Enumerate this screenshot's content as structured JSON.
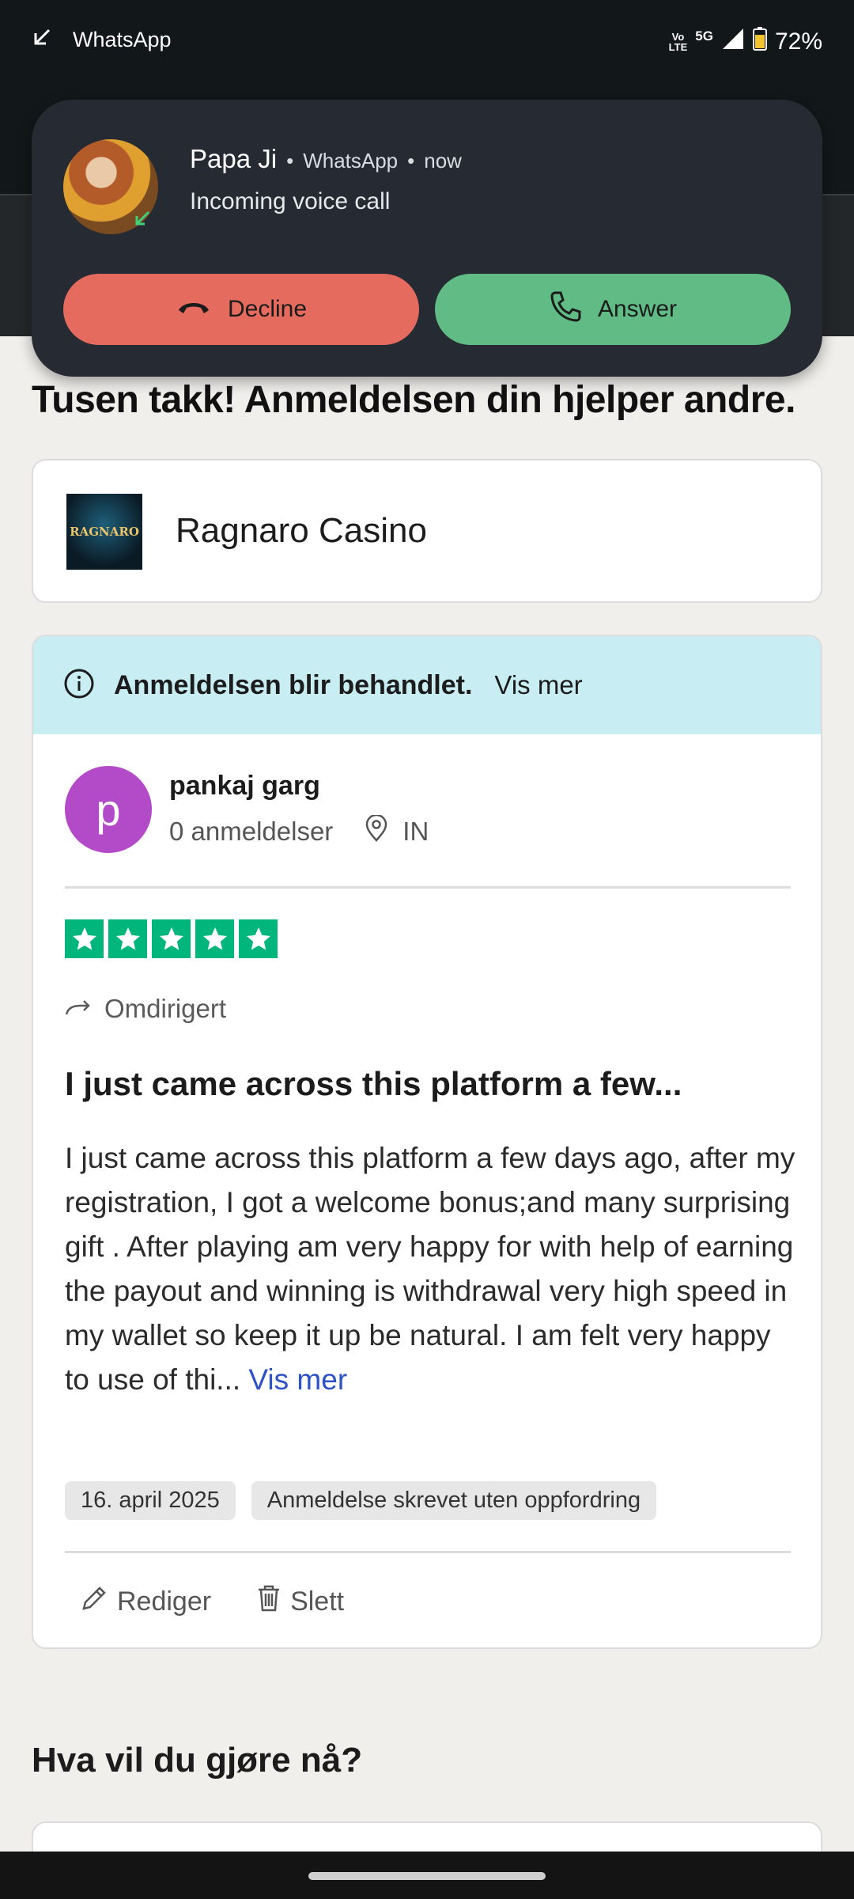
{
  "status_bar": {
    "app_name": "WhatsApp",
    "volte_top": "Vo",
    "volte_bottom": "LTE",
    "network": "5G",
    "battery": "72%"
  },
  "call_notification": {
    "caller": "Papa Ji",
    "app": "WhatsApp",
    "time": "now",
    "separator": "•",
    "message": "Incoming voice call",
    "decline_label": "Decline",
    "answer_label": "Answer"
  },
  "page": {
    "thanks_heading": "Tusen takk! Anmeldelsen din hjelper andre."
  },
  "company": {
    "logo_text": "RAGNARO",
    "name": "Ragnaro Casino"
  },
  "review": {
    "status_bold": "Anmeldelsen blir behandlet.",
    "status_link": "Vis mer",
    "user_initial": "p",
    "user_name": "pankaj garg",
    "user_reviews": "0 anmeldelser",
    "user_country": "IN",
    "rating": 5,
    "redirect_label": "Omdirigert",
    "title": "I just came across this platform a few...",
    "body": "I just came across this platform a few days ago, after my registration, I got a welcome bonus;and many surprising gift . After playing am very happy for with help of earning the payout and winning is withdrawal very high speed in my wallet so keep it up be natural. I am felt very happy to use of thi...",
    "body_more": "Vis mer",
    "date_chip": "16. april 2025",
    "unsolicited_chip": "Anmeldelse skrevet uten oppfordring",
    "edit_label": "Rediger",
    "delete_label": "Slett",
    "star_color": "#00b67a"
  },
  "next_section": {
    "heading": "Hva vil du gjøre nå?"
  }
}
